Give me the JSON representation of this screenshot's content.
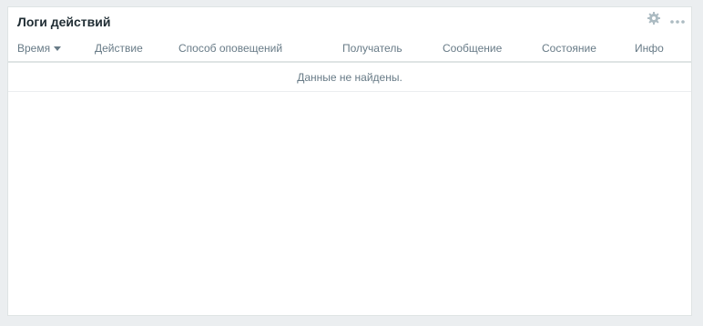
{
  "widget": {
    "title": "Логи действий",
    "icons": {
      "settings": "gear-icon",
      "more": "more-horizontal-icon"
    }
  },
  "table": {
    "columns": [
      "Время",
      "Действие",
      "Способ оповещений",
      "Получатель",
      "Сообщение",
      "Состояние",
      "Инфо"
    ],
    "sorted_column_index": 0,
    "sort_direction": "desc",
    "empty_message": "Данные не найдены."
  },
  "colors": {
    "background": "#ebeef0",
    "title": "#1f2c33",
    "header_text": "#687b87",
    "border": "#dfe4e4",
    "icon": "#acbbc2"
  }
}
